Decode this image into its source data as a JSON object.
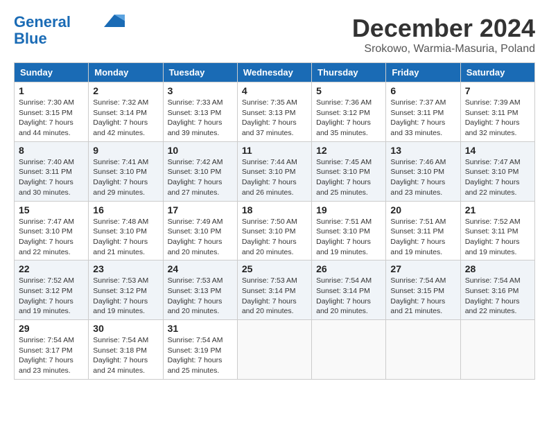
{
  "logo": {
    "line1": "General",
    "line2": "Blue"
  },
  "title": "December 2024",
  "subtitle": "Srokowo, Warmia-Masuria, Poland",
  "days_of_week": [
    "Sunday",
    "Monday",
    "Tuesday",
    "Wednesday",
    "Thursday",
    "Friday",
    "Saturday"
  ],
  "weeks": [
    [
      {
        "day": "1",
        "sunrise": "7:30 AM",
        "sunset": "3:15 PM",
        "daylight": "7 hours and 44 minutes."
      },
      {
        "day": "2",
        "sunrise": "7:32 AM",
        "sunset": "3:14 PM",
        "daylight": "7 hours and 42 minutes."
      },
      {
        "day": "3",
        "sunrise": "7:33 AM",
        "sunset": "3:13 PM",
        "daylight": "7 hours and 39 minutes."
      },
      {
        "day": "4",
        "sunrise": "7:35 AM",
        "sunset": "3:13 PM",
        "daylight": "7 hours and 37 minutes."
      },
      {
        "day": "5",
        "sunrise": "7:36 AM",
        "sunset": "3:12 PM",
        "daylight": "7 hours and 35 minutes."
      },
      {
        "day": "6",
        "sunrise": "7:37 AM",
        "sunset": "3:11 PM",
        "daylight": "7 hours and 33 minutes."
      },
      {
        "day": "7",
        "sunrise": "7:39 AM",
        "sunset": "3:11 PM",
        "daylight": "7 hours and 32 minutes."
      }
    ],
    [
      {
        "day": "8",
        "sunrise": "7:40 AM",
        "sunset": "3:11 PM",
        "daylight": "7 hours and 30 minutes."
      },
      {
        "day": "9",
        "sunrise": "7:41 AM",
        "sunset": "3:10 PM",
        "daylight": "7 hours and 29 minutes."
      },
      {
        "day": "10",
        "sunrise": "7:42 AM",
        "sunset": "3:10 PM",
        "daylight": "7 hours and 27 minutes."
      },
      {
        "day": "11",
        "sunrise": "7:44 AM",
        "sunset": "3:10 PM",
        "daylight": "7 hours and 26 minutes."
      },
      {
        "day": "12",
        "sunrise": "7:45 AM",
        "sunset": "3:10 PM",
        "daylight": "7 hours and 25 minutes."
      },
      {
        "day": "13",
        "sunrise": "7:46 AM",
        "sunset": "3:10 PM",
        "daylight": "7 hours and 23 minutes."
      },
      {
        "day": "14",
        "sunrise": "7:47 AM",
        "sunset": "3:10 PM",
        "daylight": "7 hours and 22 minutes."
      }
    ],
    [
      {
        "day": "15",
        "sunrise": "7:47 AM",
        "sunset": "3:10 PM",
        "daylight": "7 hours and 22 minutes."
      },
      {
        "day": "16",
        "sunrise": "7:48 AM",
        "sunset": "3:10 PM",
        "daylight": "7 hours and 21 minutes."
      },
      {
        "day": "17",
        "sunrise": "7:49 AM",
        "sunset": "3:10 PM",
        "daylight": "7 hours and 20 minutes."
      },
      {
        "day": "18",
        "sunrise": "7:50 AM",
        "sunset": "3:10 PM",
        "daylight": "7 hours and 20 minutes."
      },
      {
        "day": "19",
        "sunrise": "7:51 AM",
        "sunset": "3:10 PM",
        "daylight": "7 hours and 19 minutes."
      },
      {
        "day": "20",
        "sunrise": "7:51 AM",
        "sunset": "3:11 PM",
        "daylight": "7 hours and 19 minutes."
      },
      {
        "day": "21",
        "sunrise": "7:52 AM",
        "sunset": "3:11 PM",
        "daylight": "7 hours and 19 minutes."
      }
    ],
    [
      {
        "day": "22",
        "sunrise": "7:52 AM",
        "sunset": "3:12 PM",
        "daylight": "7 hours and 19 minutes."
      },
      {
        "day": "23",
        "sunrise": "7:53 AM",
        "sunset": "3:12 PM",
        "daylight": "7 hours and 19 minutes."
      },
      {
        "day": "24",
        "sunrise": "7:53 AM",
        "sunset": "3:13 PM",
        "daylight": "7 hours and 20 minutes."
      },
      {
        "day": "25",
        "sunrise": "7:53 AM",
        "sunset": "3:14 PM",
        "daylight": "7 hours and 20 minutes."
      },
      {
        "day": "26",
        "sunrise": "7:54 AM",
        "sunset": "3:14 PM",
        "daylight": "7 hours and 20 minutes."
      },
      {
        "day": "27",
        "sunrise": "7:54 AM",
        "sunset": "3:15 PM",
        "daylight": "7 hours and 21 minutes."
      },
      {
        "day": "28",
        "sunrise": "7:54 AM",
        "sunset": "3:16 PM",
        "daylight": "7 hours and 22 minutes."
      }
    ],
    [
      {
        "day": "29",
        "sunrise": "7:54 AM",
        "sunset": "3:17 PM",
        "daylight": "7 hours and 23 minutes."
      },
      {
        "day": "30",
        "sunrise": "7:54 AM",
        "sunset": "3:18 PM",
        "daylight": "7 hours and 24 minutes."
      },
      {
        "day": "31",
        "sunrise": "7:54 AM",
        "sunset": "3:19 PM",
        "daylight": "7 hours and 25 minutes."
      },
      null,
      null,
      null,
      null
    ]
  ]
}
